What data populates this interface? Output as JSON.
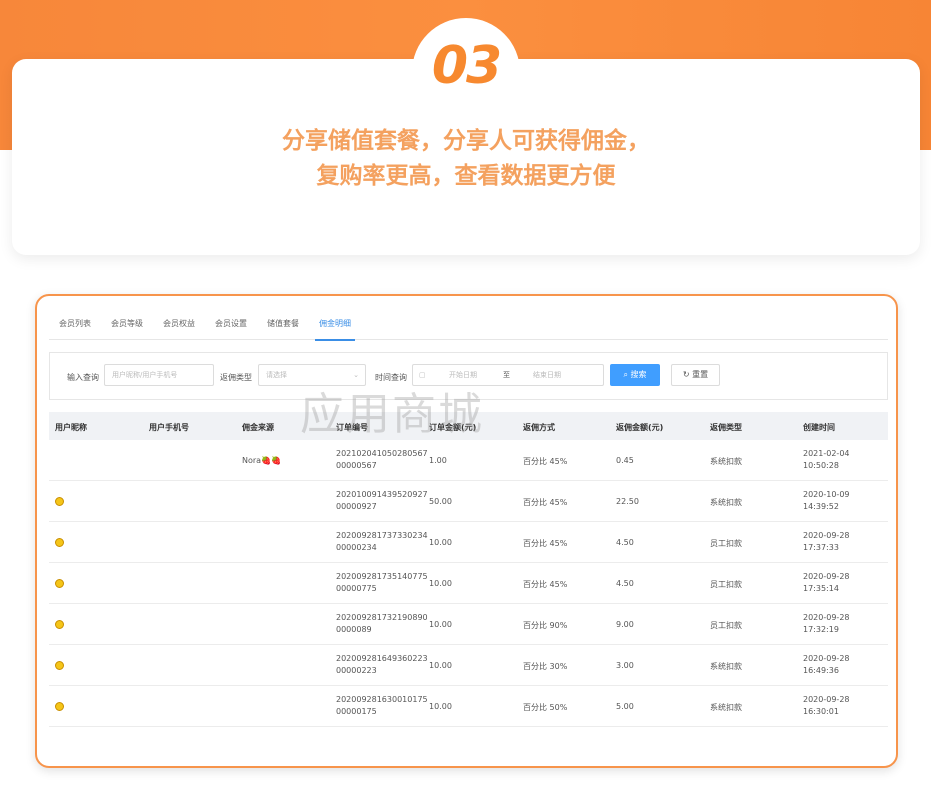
{
  "hero": {
    "badge": "03",
    "line1": "分享储值套餐，分享人可获得佣金，",
    "line2": "复购率更高，查看数据更方便"
  },
  "tabs": [
    {
      "label": "会员列表",
      "active": false
    },
    {
      "label": "会员等级",
      "active": false
    },
    {
      "label": "会员权益",
      "active": false
    },
    {
      "label": "会员设置",
      "active": false
    },
    {
      "label": "储值套餐",
      "active": false
    },
    {
      "label": "佣金明细",
      "active": true
    }
  ],
  "filters": {
    "query_label": "输入查询",
    "query_placeholder": "用户昵称/用户手机号",
    "type_label": "返佣类型",
    "type_placeholder": "请选择",
    "time_label": "时间查询",
    "start_placeholder": "开始日期",
    "to": "至",
    "end_placeholder": "结束日期",
    "search": "搜索",
    "reset": "重置"
  },
  "table": {
    "headers": [
      "用户昵称",
      "用户手机号",
      "佣金来源",
      "订单编号",
      "订单金额(元)",
      "返佣方式",
      "返佣金额(元)",
      "返佣类型",
      "创建时间"
    ],
    "rows": [
      {
        "nickname": "",
        "phone": "",
        "source": "Nora🍓🍓",
        "order_no": "202102041050280567\n00000567",
        "amount": "1.00",
        "method": "百分比 45%",
        "commission": "0.45",
        "type": "系统扣款",
        "created": "2021-02-04\n10:50:28",
        "emoji": false
      },
      {
        "nickname": "",
        "phone": "",
        "source": "",
        "order_no": "202010091439520927\n00000927",
        "amount": "50.00",
        "method": "百分比 45%",
        "commission": "22.50",
        "type": "系统扣款",
        "created": "2020-10-09\n14:39:52",
        "emoji": true
      },
      {
        "nickname": "",
        "phone": "",
        "source": "",
        "order_no": "202009281737330234\n00000234",
        "amount": "10.00",
        "method": "百分比 45%",
        "commission": "4.50",
        "type": "员工扣款",
        "created": "2020-09-28\n17:37:33",
        "emoji": true
      },
      {
        "nickname": "",
        "phone": "",
        "source": "",
        "order_no": "202009281735140775\n00000775",
        "amount": "10.00",
        "method": "百分比 45%",
        "commission": "4.50",
        "type": "员工扣款",
        "created": "2020-09-28\n17:35:14",
        "emoji": true
      },
      {
        "nickname": "",
        "phone": "",
        "source": "",
        "order_no": "202009281732190890\n0000089",
        "amount": "10.00",
        "method": "百分比 90%",
        "commission": "9.00",
        "type": "员工扣款",
        "created": "2020-09-28\n17:32:19",
        "emoji": true
      },
      {
        "nickname": "",
        "phone": "",
        "source": "",
        "order_no": "202009281649360223\n00000223",
        "amount": "10.00",
        "method": "百分比 30%",
        "commission": "3.00",
        "type": "系统扣款",
        "created": "2020-09-28\n16:49:36",
        "emoji": true
      },
      {
        "nickname": "",
        "phone": "",
        "source": "",
        "order_no": "202009281630010175\n00000175",
        "amount": "10.00",
        "method": "百分比 50%",
        "commission": "5.00",
        "type": "系统扣款",
        "created": "2020-09-28\n16:30:01",
        "emoji": true
      }
    ]
  },
  "watermark": "应用商城",
  "colors": {
    "accent": "#f7892f",
    "primary": "#409eff"
  }
}
